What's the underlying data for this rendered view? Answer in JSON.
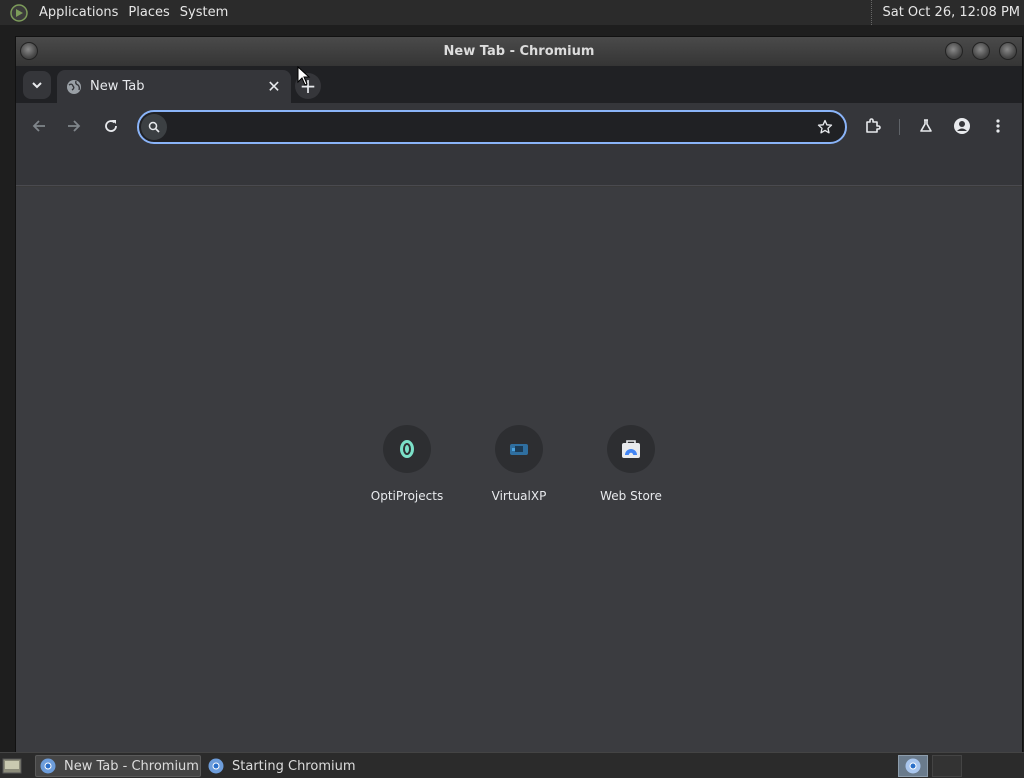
{
  "top_panel": {
    "menus": [
      "Applications",
      "Places",
      "System"
    ],
    "clock": "Sat Oct 26, 12:08 PM"
  },
  "window": {
    "title": "New Tab - Chromium"
  },
  "browser": {
    "tab": {
      "title": "New Tab",
      "favicon": "globe-icon",
      "close_glyph": "✕"
    },
    "new_tab_glyph": "+",
    "omnibox": {
      "value": "",
      "placeholder": ""
    }
  },
  "shortcuts": [
    {
      "label": "OptiProjects",
      "icon": "optiprojects-icon"
    },
    {
      "label": "VirtualXP",
      "icon": "virtualxp-icon"
    },
    {
      "label": "Web Store",
      "icon": "web-store-icon"
    }
  ],
  "taskbar": {
    "tasks": [
      {
        "label": "New Tab - Chromium",
        "active": true
      },
      {
        "label": "Starting Chromium",
        "active": false
      }
    ]
  },
  "colors": {
    "accent": "#8ab4f8",
    "content_bg": "#3b3c40",
    "toolbar_bg": "#35363a",
    "tabstrip_bg": "#202124"
  }
}
